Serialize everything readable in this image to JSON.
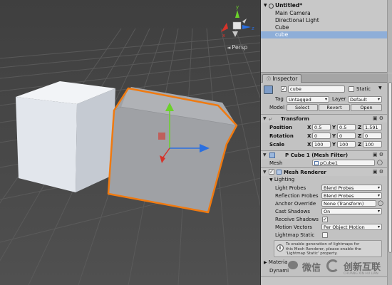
{
  "hierarchy": {
    "scene_name": "Untitled*",
    "items": [
      "Main Camera",
      "Directional Light",
      "Cube",
      "cube"
    ],
    "selected_index": 3
  },
  "scene_view": {
    "projection_label": "Persp",
    "gizmo_axes": [
      "y",
      "x",
      "z"
    ]
  },
  "inspector": {
    "tab_label": "Inspector",
    "object_name": "cube",
    "static_label": "Static",
    "tag_label": "Tag",
    "tag_value": "Untagged",
    "layer_label": "Layer",
    "layer_value": "Default",
    "model_label": "Model",
    "model_buttons": [
      "Select",
      "Revert",
      "Open"
    ],
    "transform": {
      "title": "Transform",
      "rows": [
        {
          "label": "Position",
          "x": "0.5",
          "y": "0.5",
          "z": "1.591"
        },
        {
          "label": "Rotation",
          "x": "0",
          "y": "0",
          "z": "0"
        },
        {
          "label": "Scale",
          "x": "100",
          "y": "100",
          "z": "100"
        }
      ],
      "axis_labels": [
        "X",
        "Y",
        "Z"
      ]
    },
    "mesh_filter": {
      "title": "P Cube 1 (Mesh Filter)",
      "mesh_label": "Mesh",
      "mesh_value": "pCube1"
    },
    "mesh_renderer": {
      "title": "Mesh Renderer",
      "lighting_label": "Lighting",
      "fields": [
        {
          "label": "Light Probes",
          "value": "Blend Probes"
        },
        {
          "label": "Reflection Probes",
          "value": "Blend Probes"
        },
        {
          "label": "Anchor Override",
          "value": "None (Transform)"
        },
        {
          "label": "Cast Shadows",
          "value": "On"
        },
        {
          "label": "Receive Shadows",
          "value": "checked"
        },
        {
          "label": "Motion Vectors",
          "value": "Per Object Motion"
        },
        {
          "label": "Lightmap Static",
          "value": "unchecked"
        }
      ],
      "help_text": [
        "To enable generation of lightmaps for",
        "this Mesh Renderer, please enable the",
        "'Lightmap Static' property."
      ],
      "materials_label": "Materia",
      "dynamic_label": "Dynami"
    }
  },
  "watermark": {
    "text_left": "微信",
    "text_right": "创新互联",
    "sub": "CHUANG XIN HU LIAN"
  },
  "colors": {
    "selection_outline": "#f07a10",
    "hierarchy_selected": "#8eaed8",
    "gizmo_y": "#6bd12a",
    "gizmo_x": "#d6332a",
    "gizmo_z": "#2a6fe0"
  }
}
